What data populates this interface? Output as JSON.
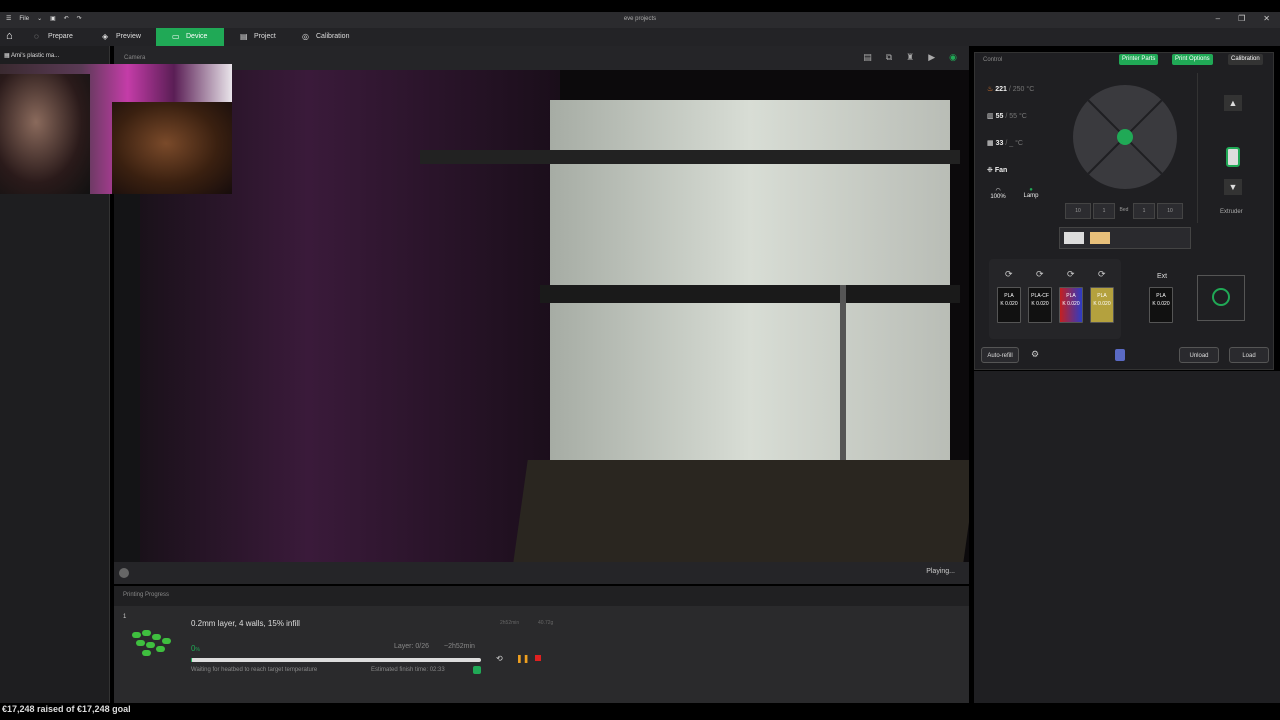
{
  "app": {
    "file_label": "File",
    "title": "eve projects"
  },
  "nav": {
    "tabs": [
      {
        "label": "Prepare"
      },
      {
        "label": "Preview"
      },
      {
        "label": "Device"
      },
      {
        "label": "Project"
      },
      {
        "label": "Calibration"
      }
    ]
  },
  "sidebar": {
    "item_label": "Ami's plastic ma..."
  },
  "camera": {
    "label": "Camera",
    "status": "Playing..."
  },
  "progress": {
    "section_title": "Printing Progress",
    "plate_number": "1",
    "job_name": "0.2mm layer, 4 walls, 15% infill",
    "time_small": "2h52min",
    "weight_small": "40.72g",
    "percent": "0",
    "percent_unit": "%",
    "layer": "Layer: 0/26",
    "remaining": "~2h52min",
    "message": "Waiting for heatbed to reach target temperature",
    "estimated_finish": "Estimated finish time: 02:33",
    "progress_fraction": 0.0
  },
  "control": {
    "title": "Control",
    "buttons": {
      "printer_parts": "Printer Parts",
      "print_options": "Print Options",
      "calibration": "Calibration"
    },
    "nozzle": {
      "current": "221",
      "target": "/ 250",
      "unit": "°C"
    },
    "bed": {
      "current": "55",
      "target": "/ 55",
      "unit": "°C"
    },
    "chamber": {
      "current": "33",
      "target": "/ _",
      "unit": "°C"
    },
    "fan_label": "Fan",
    "fan_speed": "100%",
    "lamp_label": "Lamp",
    "z_buttons": [
      "10",
      "1",
      "Bed",
      "1",
      "10"
    ],
    "extruder_label": "Extruder",
    "ams_slots": [
      {
        "material": "PLA",
        "k": "K 0.020",
        "color": "#111111"
      },
      {
        "material": "PLA-CF",
        "k": "K 0.020",
        "color": "#111111"
      },
      {
        "material": "PLA",
        "k": "K 0.020",
        "color": "#2d3cc4"
      },
      {
        "material": "PLA",
        "k": "K 0.020",
        "color": "#b4a13e"
      }
    ],
    "ext_label": "Ext",
    "ext_spool": {
      "material": "PLA",
      "k": "K 0.020"
    },
    "auto_refill": "Auto-refill",
    "unload": "Unload",
    "load": "Load"
  },
  "overlay": {
    "fundraiser": "€17,248 raised of €17,248 goal"
  },
  "colors": {
    "accent": "#20a956",
    "panel": "#1f1f22",
    "text": "#cfcfcf"
  }
}
